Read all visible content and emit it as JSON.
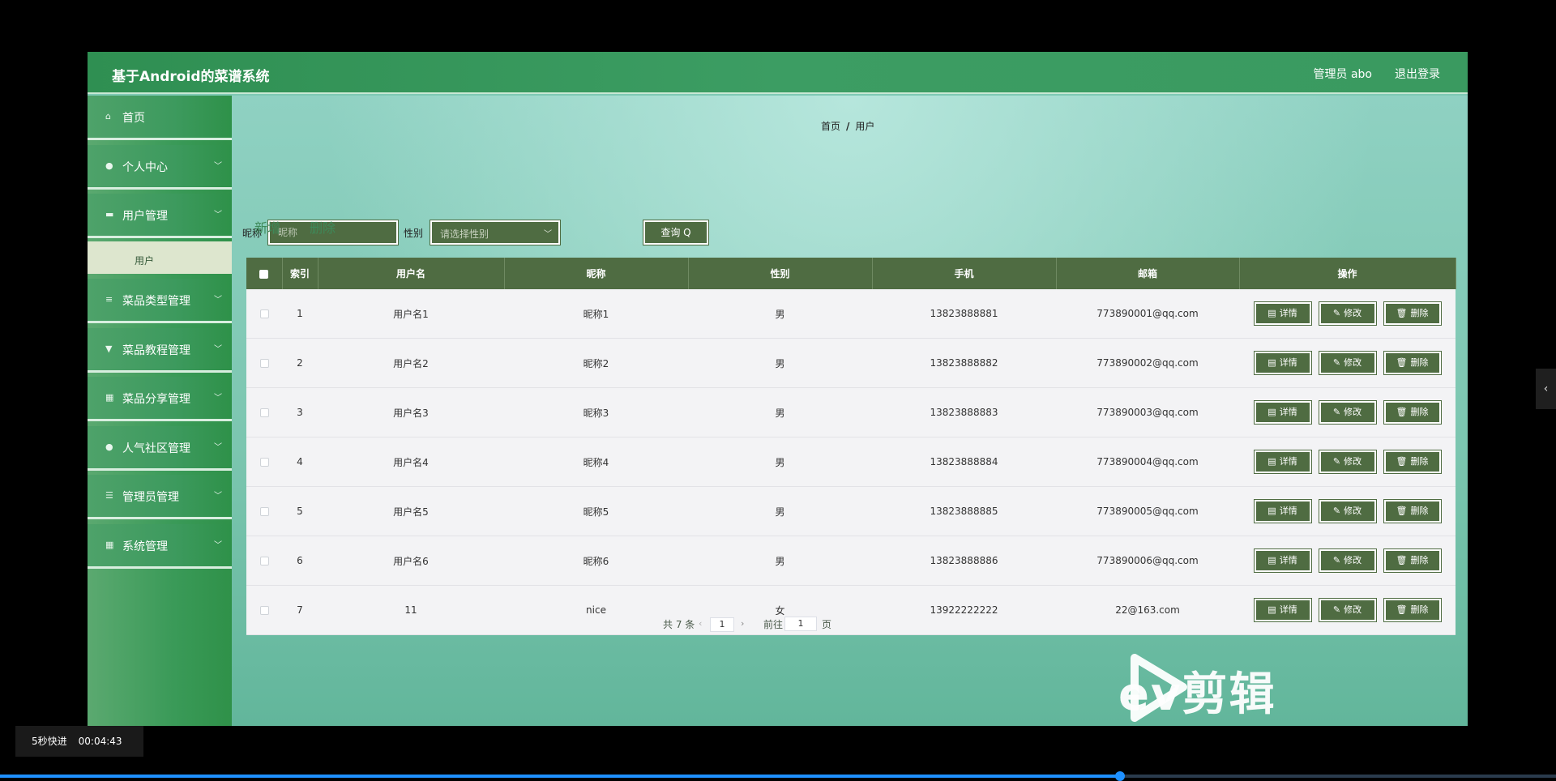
{
  "header": {
    "site_title": "基于Android的菜谱系统",
    "admin_user": "管理员 abo",
    "logout": "退出登录"
  },
  "sidebar": {
    "items": [
      {
        "label": "首页",
        "icon": "home-icon",
        "glyph": "⌂",
        "has_children": false
      },
      {
        "label": "个人中心",
        "icon": "user-icon",
        "glyph": "●",
        "has_children": true
      },
      {
        "label": "用户管理",
        "icon": "monitor-icon",
        "glyph": "▬",
        "has_children": true
      },
      {
        "label": "菜品类型管理",
        "icon": "list-icon",
        "glyph": "≡",
        "has_children": true
      },
      {
        "label": "菜品教程管理",
        "icon": "trophy-icon",
        "glyph": "▼",
        "has_children": true
      },
      {
        "label": "菜品分享管理",
        "icon": "grid-icon",
        "glyph": "▦",
        "has_children": true
      },
      {
        "label": "人气社区管理",
        "icon": "location-icon",
        "glyph": "●",
        "has_children": true
      },
      {
        "label": "管理员管理",
        "icon": "sliders-icon",
        "glyph": "☰",
        "has_children": true
      },
      {
        "label": "系统管理",
        "icon": "grid-icon",
        "glyph": "▦",
        "has_children": true
      }
    ],
    "submenu": {
      "label": "用户"
    }
  },
  "breadcrumb": {
    "home": "首页",
    "separator": "/",
    "current": "用户"
  },
  "search": {
    "nickname_label": "昵称",
    "nickname_placeholder": "昵称",
    "gender_label": "性别",
    "gender_placeholder": "请选择性别",
    "query_label": "查询 Q"
  },
  "actions": {
    "add": "新增",
    "delete": "删除"
  },
  "table": {
    "headers": [
      "索引",
      "用户名",
      "昵称",
      "性别",
      "手机",
      "邮箱",
      "操作"
    ],
    "rows": [
      {
        "index": "1",
        "username": "用户名1",
        "nickname": "昵称1",
        "gender": "男",
        "phone": "13823888881",
        "email": "773890001@qq.com"
      },
      {
        "index": "2",
        "username": "用户名2",
        "nickname": "昵称2",
        "gender": "男",
        "phone": "13823888882",
        "email": "773890002@qq.com"
      },
      {
        "index": "3",
        "username": "用户名3",
        "nickname": "昵称3",
        "gender": "男",
        "phone": "13823888883",
        "email": "773890003@qq.com"
      },
      {
        "index": "4",
        "username": "用户名4",
        "nickname": "昵称4",
        "gender": "男",
        "phone": "13823888884",
        "email": "773890004@qq.com"
      },
      {
        "index": "5",
        "username": "用户名5",
        "nickname": "昵称5",
        "gender": "男",
        "phone": "13823888885",
        "email": "773890005@qq.com"
      },
      {
        "index": "6",
        "username": "用户名6",
        "nickname": "昵称6",
        "gender": "男",
        "phone": "13823888886",
        "email": "773890006@qq.com"
      },
      {
        "index": "7",
        "username": "11",
        "nickname": "nice",
        "gender": "女",
        "phone": "13922222222",
        "email": "22@163.com"
      }
    ],
    "row_actions": {
      "detail": "详情",
      "edit": "修改",
      "delete": "删除"
    }
  },
  "pagination": {
    "total": "共 7 条",
    "prev": "‹",
    "current_page": "1",
    "next": "›",
    "goto_label": "前往",
    "goto_value": "1",
    "page_suffix": "页"
  },
  "watermark": {
    "text": "ev剪辑"
  },
  "video": {
    "skip_label": "5秒快进",
    "timestamp": "00:04:43",
    "progress": 0.72
  },
  "colors": {
    "header_green": "#3a9a5e",
    "table_header": "#4f6c42",
    "button_green": "#4f6c42",
    "progress_blue": "#1e90ff"
  }
}
